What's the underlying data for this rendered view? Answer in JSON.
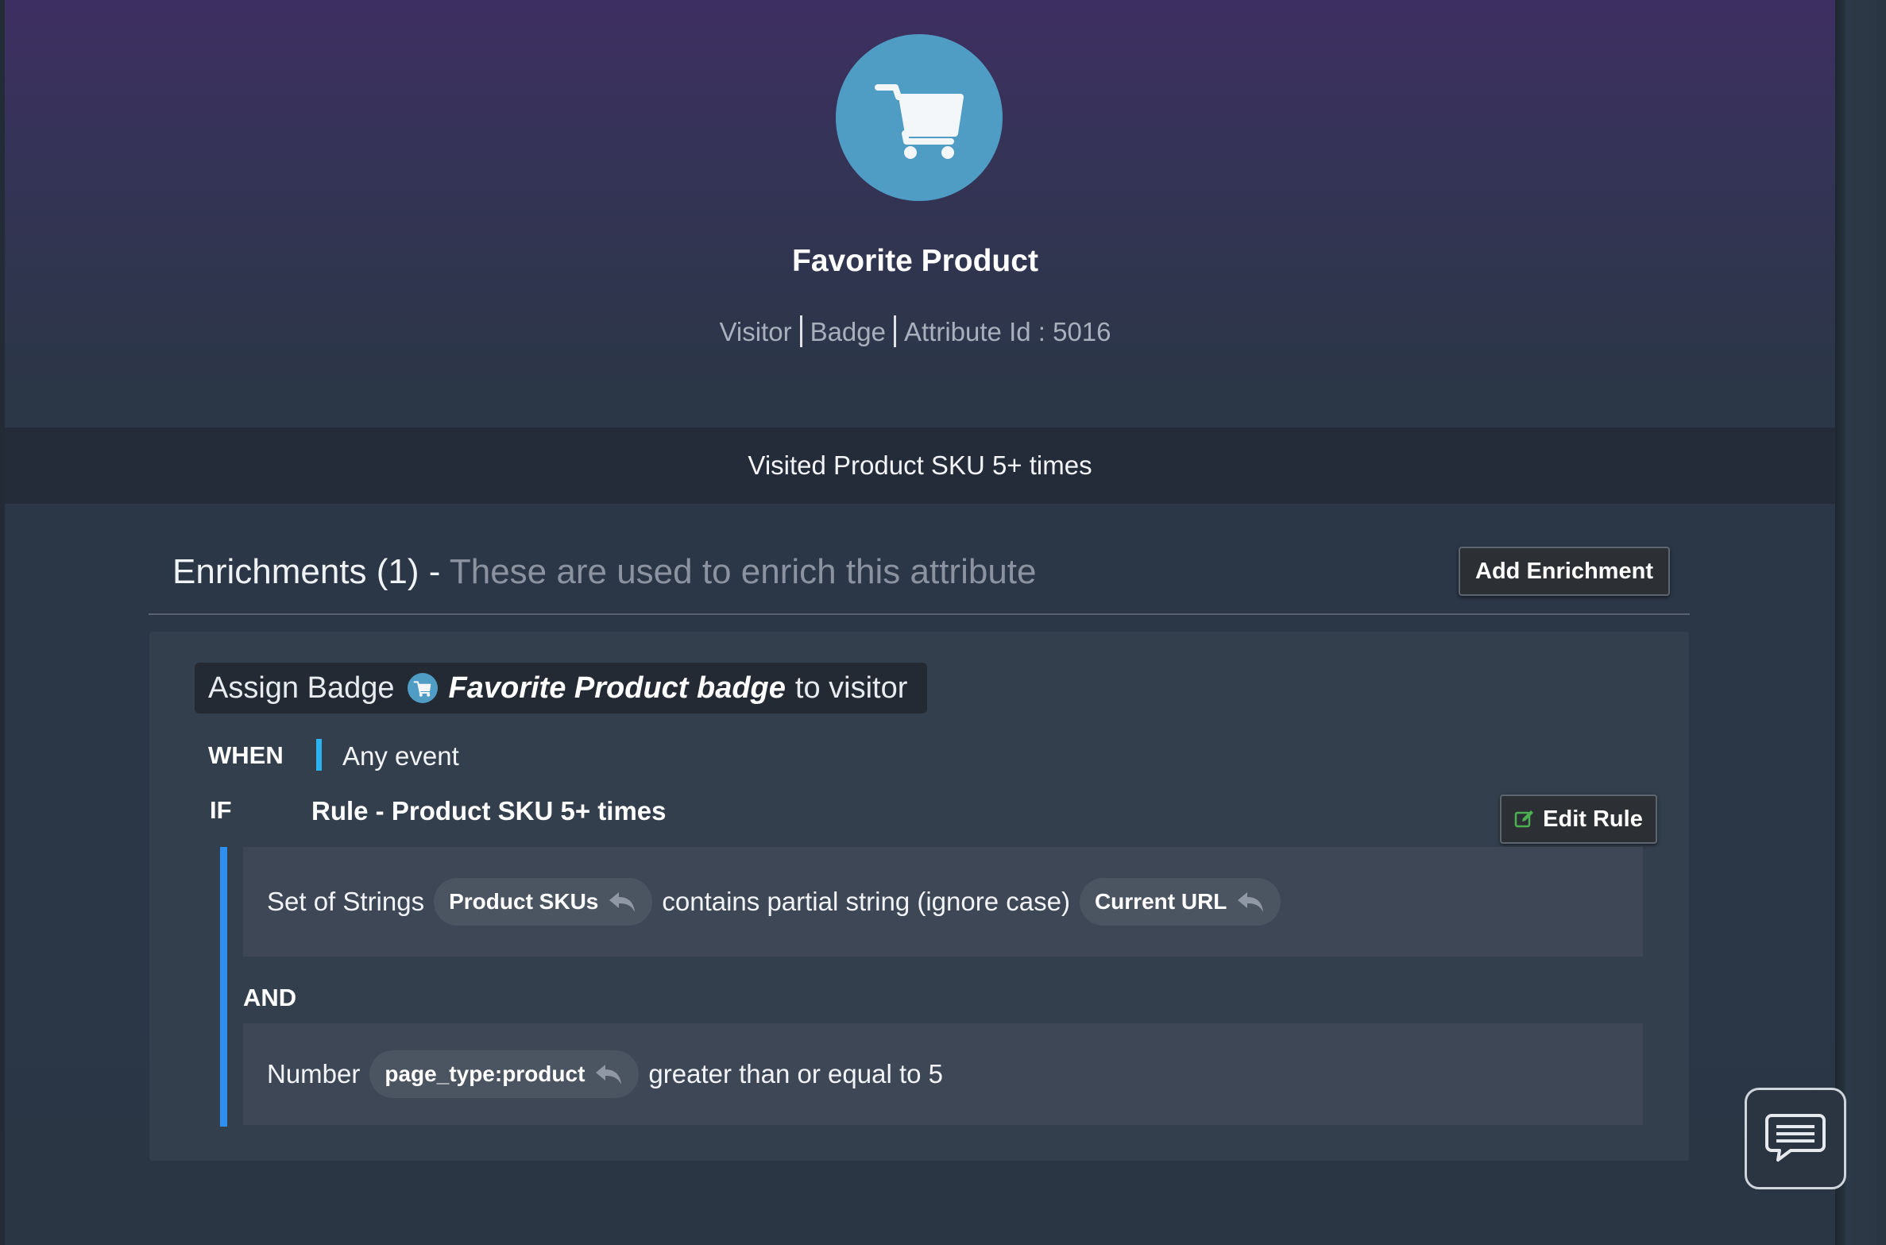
{
  "attribute": {
    "name": "Favorite Product",
    "icon": "shopping-cart-icon",
    "accent_color": "#4f9cc4",
    "meta": {
      "type": "Visitor",
      "kind": "Badge",
      "attribute_id": "Attribute Id : 5016"
    },
    "description": "Visited Product SKU 5+ times"
  },
  "enrichments": {
    "title": "Enrichments (1) -",
    "subtitle": "These are used to enrich this attribute",
    "add_button": "Add Enrichment",
    "items": [
      {
        "action_prefix": "Assign Badge",
        "badge_name": "Favorite Product badge",
        "action_suffix": "to visitor",
        "when_label": "WHEN",
        "when_value": "Any event",
        "if_label": "IF",
        "rule_name": "Rule - Product SKU 5+ times",
        "edit_button": "Edit Rule",
        "conditions": [
          {
            "operand_type": "Set of Strings",
            "left_chip": "Product SKUs",
            "operator": "contains partial string (ignore case)",
            "right_chip": "Current URL"
          },
          {
            "connector": "AND",
            "operand_type": "Number",
            "left_chip": "page_type:product",
            "operator": "greater than or equal to 5"
          }
        ]
      }
    ]
  },
  "chat": {
    "icon": "chat-bubble-icon"
  }
}
